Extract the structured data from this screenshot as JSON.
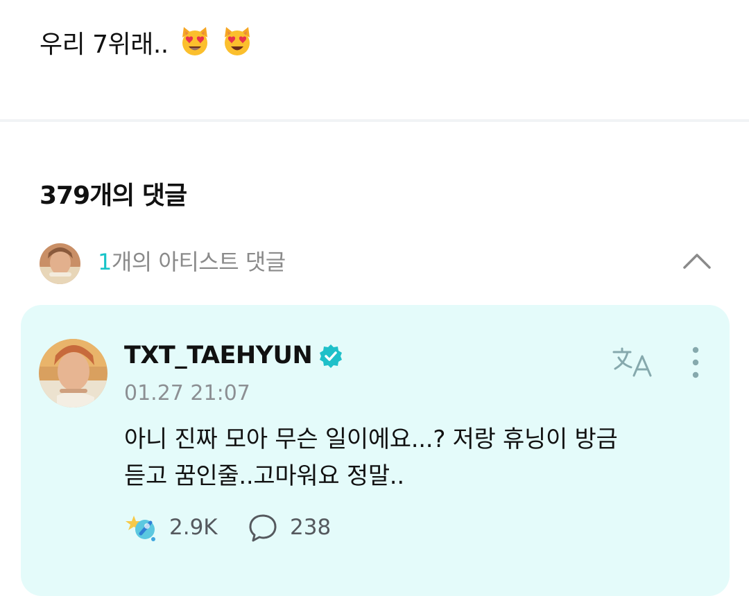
{
  "post": {
    "text": "우리 7위래.."
  },
  "comments": {
    "heading": "379개의 댓글",
    "artist_row": {
      "count": "1",
      "label": "개의 아티스트 댓글"
    }
  },
  "artist_comment": {
    "author": "TXT_TAEHYUN",
    "timestamp": "01.27 21:07",
    "body_lines": [
      "아니 진짜 모아 무슨 일이에요...? 저랑 휴닝이 방금",
      "듣고 꿈인줄..고마워요 정말.."
    ],
    "likes": "2.9K",
    "replies": "238"
  },
  "colors": {
    "accent": "#18c4c8",
    "card_background": "#e4fbfa",
    "verified_badge": "#1fc0c9"
  },
  "icons": [
    "heart-eyes-cat-emoji",
    "chevron-up-icon",
    "verified-badge-icon",
    "translate-icon",
    "more-vertical-icon",
    "like-icon",
    "reply-bubble-icon"
  ]
}
